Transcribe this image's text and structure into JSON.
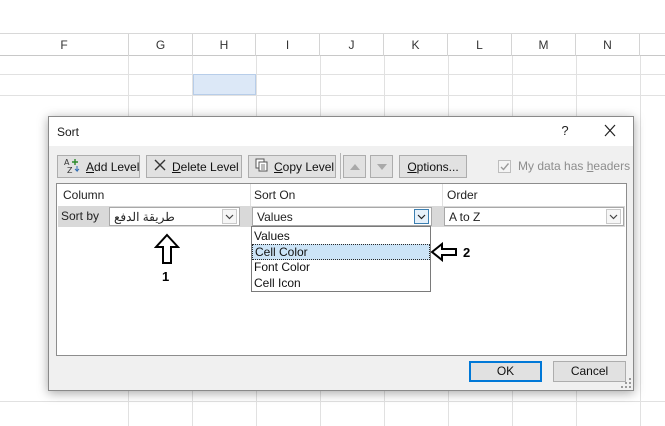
{
  "sheet": {
    "columns": [
      "F",
      "G",
      "H",
      "I",
      "J",
      "K",
      "L",
      "M",
      "N"
    ]
  },
  "dialog": {
    "title": "Sort",
    "help_label": "?",
    "toolbar": {
      "add_level_pre": "",
      "add_level_key": "A",
      "add_level_post": "dd Level",
      "delete_level_pre": "",
      "delete_level_key": "D",
      "delete_level_post": "elete Level",
      "copy_level_pre": "",
      "copy_level_key": "C",
      "copy_level_post": "opy Level",
      "options_pre": "",
      "options_key": "O",
      "options_post": "ptions..."
    },
    "headers_checkbox": {
      "label_pre": "My data has ",
      "label_key": "h",
      "label_post": "eaders",
      "checked": true
    },
    "columns": {
      "column": "Column",
      "sort_on": "Sort On",
      "order": "Order"
    },
    "row": {
      "sort_by_label": "Sort by",
      "column_value": "طريقة الدفع",
      "sort_on_value": "Values",
      "order_value": "A to Z"
    },
    "sort_on_options": [
      "Values",
      "Cell Color",
      "Font Color",
      "Cell Icon"
    ],
    "selected_option": "Cell Color",
    "ok_label": "OK",
    "cancel_label": "Cancel"
  },
  "annotations": {
    "label_1": "1",
    "label_2": "2"
  },
  "colors": {
    "selection_highlight": "#cce4f7",
    "ok_focus_border": "#0078d7",
    "selected_cell_fill": "#dce8f7"
  }
}
